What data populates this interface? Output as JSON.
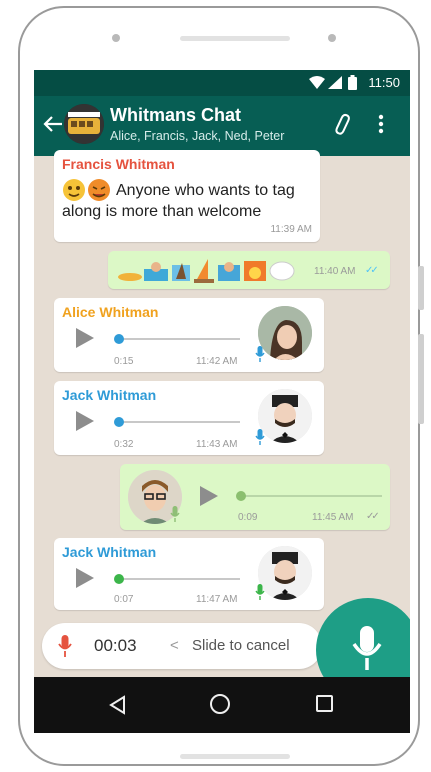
{
  "status_bar": {
    "time": "11:50"
  },
  "app_bar": {
    "title": "Whitmans Chat",
    "subtitle": "Alice, Francis, Jack, Ned, Peter"
  },
  "messages": [
    {
      "sender": "Francis Whitman",
      "text_line1": "Anyone who wants to tag",
      "text_line2": "along is more than welcome",
      "time": "11:39 AM"
    },
    {
      "time": "11:40 AM"
    },
    {
      "sender": "Alice Whitman",
      "duration": "0:15",
      "time": "11:42 AM",
      "progress": 0.0
    },
    {
      "sender": "Jack Whitman",
      "duration": "0:32",
      "time": "11:43 AM",
      "progress": 0.0
    },
    {
      "duration": "0:09",
      "time": "11:45 AM",
      "progress": 0.0
    },
    {
      "sender": "Jack Whitman",
      "duration": "0:07",
      "time": "11:47 AM",
      "progress": 0.0
    }
  ],
  "recording": {
    "elapsed": "00:03",
    "chevron": "<",
    "hint": "Slide to cancel"
  },
  "colors": {
    "header": "#075e54",
    "status": "#054d44",
    "fab": "#1e9e86",
    "francis": "#e5533f",
    "alice": "#f0a21f",
    "jack": "#2f9bd7",
    "out_bubble": "#dcf8c6",
    "wallpaper": "#e6ddd3"
  },
  "icons": [
    "back-arrow-icon",
    "wifi-icon",
    "signal-icon",
    "battery-icon",
    "paperclip-icon",
    "more-vert-icon",
    "play-icon",
    "mic-icon",
    "nav-back-icon",
    "nav-home-icon",
    "nav-recents-icon"
  ]
}
